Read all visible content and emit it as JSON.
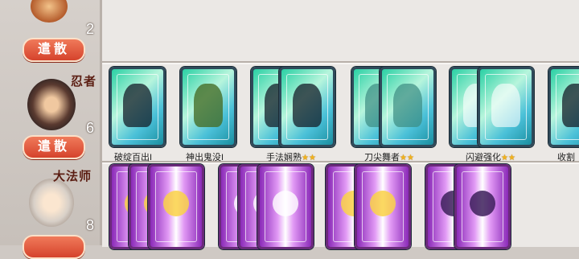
{
  "colors": {
    "accent": "#d5432c",
    "star": "#f2b21c"
  },
  "characters": [
    {
      "name": "",
      "level": "2",
      "disband_label": "遣散"
    },
    {
      "name": "忍者",
      "level": "6",
      "disband_label": "遣散"
    },
    {
      "name": "大法师",
      "level": "8",
      "disband_label": ""
    }
  ],
  "row2_cards": [
    {
      "label": "破绽百出I",
      "stars": ""
    },
    {
      "label": "神出鬼没I",
      "stars": ""
    },
    {
      "label": "手法娴熟",
      "stars": "★★"
    },
    {
      "label": "刀尖舞者",
      "stars": "★★"
    },
    {
      "label": "闪避强化",
      "stars": "★★"
    },
    {
      "label": "收割",
      "stars": ""
    }
  ]
}
